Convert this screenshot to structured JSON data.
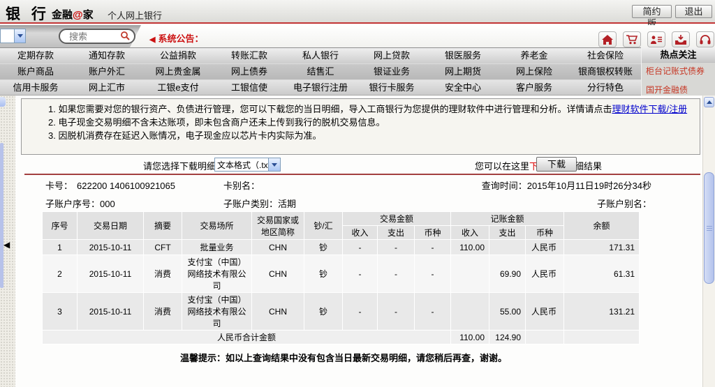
{
  "header": {
    "bank": "银 行",
    "brand_pre": "金融",
    "brand_at": "@",
    "brand_post": "家",
    "subtitle": "个人网上银行",
    "btn_simple": "简约版",
    "btn_logout": "退出"
  },
  "toolbar": {
    "search_placeholder": "搜索",
    "announcement": "系统公告："
  },
  "icons": {
    "speaker": "◀",
    "collapse_left": "◀"
  },
  "nav": {
    "rows": [
      [
        "定期存款",
        "通知存款",
        "公益捐款",
        "转账汇款",
        "私人银行",
        "网上贷款",
        "银医服务",
        "养老金",
        "社会保险"
      ],
      [
        "账户商品",
        "账户外汇",
        "网上贵金属",
        "网上债券",
        "结售汇",
        "银证业务",
        "网上期货",
        "网上保险",
        "银商银权转账"
      ],
      [
        "信用卡服务",
        "网上汇市",
        "工银e支付",
        "工银信使",
        "电子银行注册",
        "银行卡服务",
        "安全中心",
        "客户服务",
        "分行特色"
      ]
    ]
  },
  "hotspot": {
    "title": "热点关注",
    "links": [
      "柜台记账式债券",
      "国开金融债"
    ]
  },
  "notes": {
    "line1_prefix": "1. 如果您需要对您的银行资产、负债进行管理，您可以下载您的当日明细，导入工商银行为您提供的理财软件中进行管理和分析。详情请点击",
    "line1_link": "理财软件下载/注册",
    "line2": "2. 电子现金交易明细不含未达账项，即未包含商户还未上传到我行的脱机交易信息。",
    "line3": "3. 因脱机消费存在延迟入账情况，电子现金应以芯片卡内实际为准。"
  },
  "download": {
    "label": "请您选择下载明细的格式",
    "format_value": "文本格式（.txt）",
    "hint_pre": "您可以在这里",
    "hint_red": "下载",
    "hint_post": "查询明细结果",
    "button": "下载"
  },
  "account": {
    "card_label": "卡号：",
    "card_no": "622200 1406100921065",
    "alias_label": "卡别名：",
    "alias_value": "",
    "time_label": "查询时间：",
    "time_value": "2015年10月11日19时26分34秒",
    "seq_label": "子账户序号：",
    "seq_value": "000",
    "type_label": "子账户类别：",
    "type_value": "活期",
    "subalias_label": "子账户别名：",
    "subalias_value": ""
  },
  "table": {
    "h_seq": "序号",
    "h_date": "交易日期",
    "h_summary": "摘要",
    "h_place": "交易场所",
    "h_country": "交易国家或地区简称",
    "h_cash": "钞/汇",
    "h_trade_group": "交易金额",
    "h_book_group": "记账金额",
    "h_in": "收入",
    "h_out": "支出",
    "h_cur": "币种",
    "h_balance": "余额",
    "rows": [
      {
        "seq": "1",
        "date": "2015-10-11",
        "summary": "CFT",
        "place": "批量业务",
        "country": "CHN",
        "cash": "钞",
        "tin": "-",
        "tout": "-",
        "tcur": "-",
        "bin": "110.00",
        "bout": "",
        "bcur": "人民币",
        "bal": "171.31"
      },
      {
        "seq": "2",
        "date": "2015-10-11",
        "summary": "消费",
        "place": "支付宝（中国）网络技术有限公司",
        "country": "CHN",
        "cash": "钞",
        "tin": "-",
        "tout": "-",
        "tcur": "-",
        "bin": "",
        "bout": "69.90",
        "bcur": "人民币",
        "bal": "61.31"
      },
      {
        "seq": "3",
        "date": "2015-10-11",
        "summary": "消费",
        "place": "支付宝（中国）网络技术有限公司",
        "country": "CHN",
        "cash": "钞",
        "tin": "-",
        "tout": "-",
        "tcur": "-",
        "bin": "",
        "bout": "55.00",
        "bcur": "人民币",
        "bal": "131.21"
      }
    ],
    "footer_label": "人民币合计金额",
    "footer_in": "110.00",
    "footer_out": "124.90"
  },
  "reminder": "温馨提示：如以上查询结果中没有包含当日最新交易明细，请您稍后再查，谢谢。",
  "colors": {
    "accent_red": "#c23434",
    "link_blue": "#0000cc",
    "hot_link_red": "#c63825",
    "icon_red": "#b32025",
    "scroll_thumb": "#b3c2ec"
  }
}
